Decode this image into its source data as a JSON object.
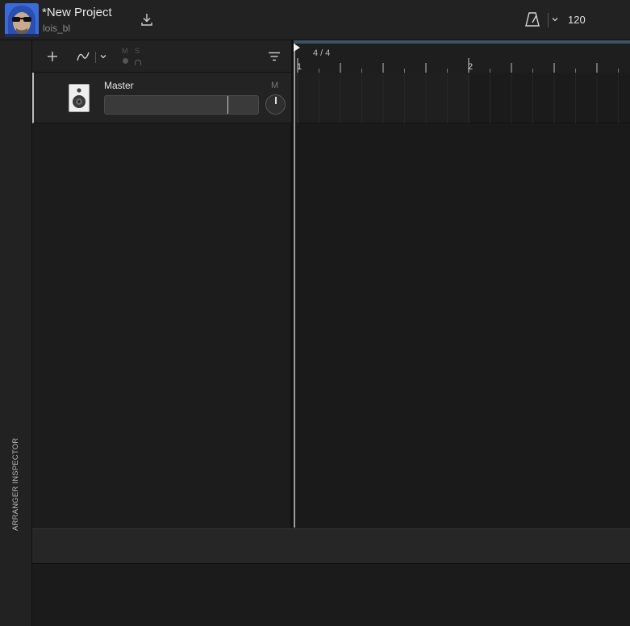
{
  "project": {
    "title": "*New Project",
    "user": "lois_bl"
  },
  "transport": {
    "tempo": "120"
  },
  "inspector": {
    "label": "ARRANGER INSPECTOR"
  },
  "track_toolbar": {
    "mute_header": "M",
    "solo_header": "S"
  },
  "tracks": [
    {
      "name": "Master",
      "mute_label": "M",
      "volume_level": 0.8
    }
  ],
  "arrangement": {
    "time_signature": "4 / 4",
    "bars": [
      "1",
      "2"
    ]
  },
  "colors": {
    "accent_bar": "#3e5366",
    "background": "#1b1b1b"
  },
  "icons": {
    "download": "download-icon",
    "metronome": "metronome-icon",
    "add": "plus-icon",
    "automation": "automation-curve-icon",
    "filter": "filter-icon",
    "speaker": "speaker-icon"
  }
}
